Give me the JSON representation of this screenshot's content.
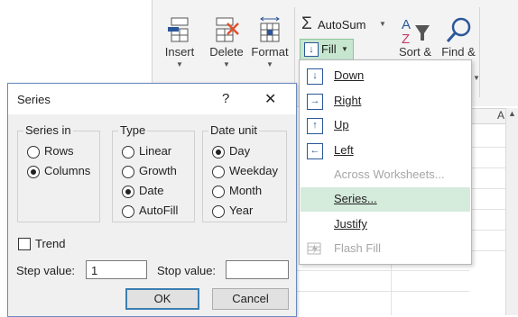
{
  "ribbon": {
    "insert_label": "Insert",
    "delete_label": "Delete",
    "format_label": "Format",
    "autosum_label": "AutoSum",
    "fill_label": "Fill",
    "sort_label": "Sort &",
    "find_label": "Find &"
  },
  "fill_menu": {
    "items": [
      {
        "label": "Down",
        "icon": "arrow-down-icon",
        "enabled": true
      },
      {
        "label": "Right",
        "icon": "arrow-right-icon",
        "enabled": true
      },
      {
        "label": "Up",
        "icon": "arrow-up-icon",
        "enabled": true
      },
      {
        "label": "Left",
        "icon": "arrow-left-icon",
        "enabled": true
      },
      {
        "label": "Across Worksheets...",
        "icon": "",
        "enabled": false
      },
      {
        "label": "Series...",
        "icon": "",
        "enabled": true,
        "highlighted": true
      },
      {
        "label": "Justify",
        "icon": "",
        "enabled": true
      },
      {
        "label": "Flash Fill",
        "icon": "flash-fill-icon",
        "enabled": false
      }
    ]
  },
  "grid": {
    "column_header": "A"
  },
  "dialog": {
    "title": "Series",
    "help": "?",
    "close": "✕",
    "series_in": {
      "title": "Series in",
      "options": [
        "Rows",
        "Columns"
      ],
      "selected": "Columns"
    },
    "type": {
      "title": "Type",
      "options": [
        "Linear",
        "Growth",
        "Date",
        "AutoFill"
      ],
      "selected": "Date"
    },
    "date_unit": {
      "title": "Date unit",
      "options": [
        "Day",
        "Weekday",
        "Month",
        "Year"
      ],
      "selected": "Day"
    },
    "trend_label": "Trend",
    "trend_checked": false,
    "step_label": "Step value:",
    "step_value": "1",
    "stop_label": "Stop value:",
    "stop_value": "",
    "ok_label": "OK",
    "cancel_label": "Cancel"
  },
  "colors": {
    "accent": "#2b579a",
    "highlight": "#d5ebdc",
    "dialog_border": "#6a8bbf"
  }
}
